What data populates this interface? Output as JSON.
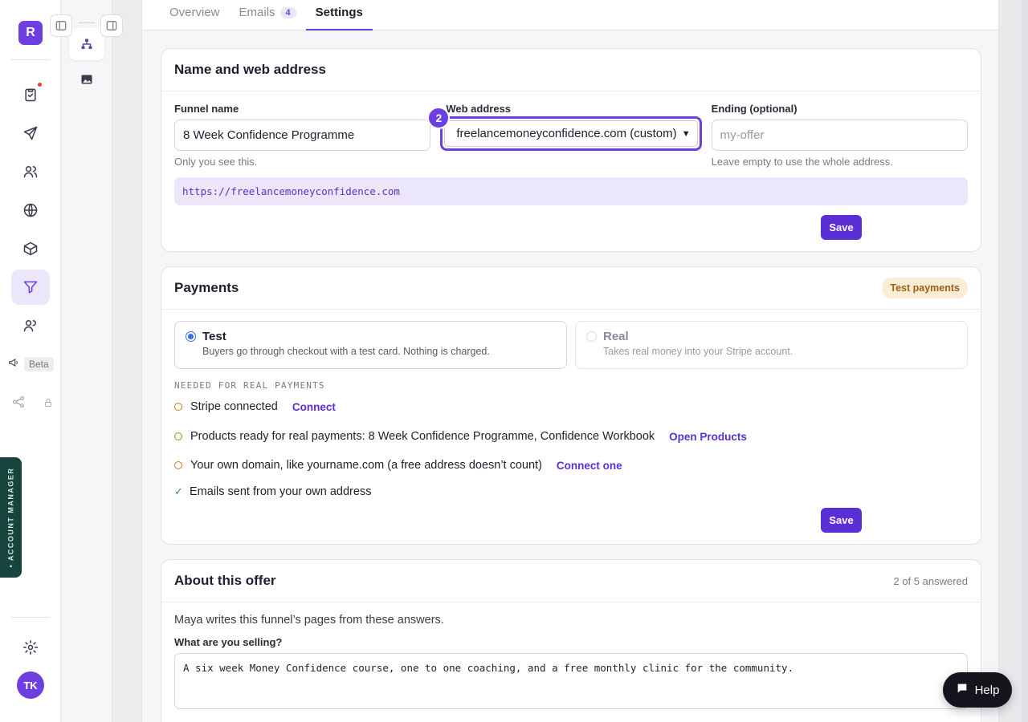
{
  "rail": {
    "workspace_initial": "R",
    "beta_label": "Beta",
    "account_manager_label": "• ACCOUNT MANAGER",
    "user_initials": "TK"
  },
  "tabs": [
    {
      "label": "Overview",
      "active": false
    },
    {
      "label": "Emails",
      "count": "4",
      "active": false
    },
    {
      "label": "Settings",
      "active": true
    }
  ],
  "name_card": {
    "title": "Name and web address",
    "funnel_label": "Funnel name",
    "funnel_value": "8 Week Confidence Programme",
    "funnel_hint": "Only you see this.",
    "web_label": "Web address",
    "web_value": "freelancemoneyconfidence.com (custom)",
    "step_badge": "2",
    "ending_label": "Ending (optional)",
    "ending_placeholder": "my-offer",
    "ending_hint": "Leave empty to use the whole address.",
    "url_preview": "https://freelancemoneyconfidence.com",
    "save_label": "Save"
  },
  "payments_card": {
    "title": "Payments",
    "status_pill": "Test payments",
    "options": [
      {
        "title": "Test",
        "subtitle": "Buyers go through checkout with a test card. Nothing is charged.",
        "selected": true
      },
      {
        "title": "Real",
        "subtitle": "Takes real money into your Stripe account.",
        "selected": false
      }
    ],
    "requirements_heading": "Needed for real payments",
    "requirements": [
      {
        "text": "Stripe connected",
        "link": "Connect",
        "done": false
      },
      {
        "text": "Products ready for real payments: 8 Week Confidence Programme, Confidence Workbook",
        "link": "Open Products",
        "done": false
      },
      {
        "text": "Your own domain, like yourname.com (a free address doesn’t count)",
        "link": "Connect one",
        "done": false
      },
      {
        "text": "Emails sent from your own address",
        "link": "",
        "done": true
      }
    ],
    "save_label": "Save"
  },
  "about_card": {
    "title": "About this offer",
    "answered": "2 of 5 answered",
    "intro": "Maya writes this funnel’s pages from these answers.",
    "q1_label": "What are you selling?",
    "q1_value": "A six week Money Confidence course, one to one coaching, and a free monthly clinic for the community."
  },
  "help": {
    "label": "Help"
  },
  "colors": {
    "accent": "#6d3fe0",
    "button": "#5a30d6",
    "test_pill_bg": "#fbecd8",
    "test_pill_text": "#9a6212"
  }
}
